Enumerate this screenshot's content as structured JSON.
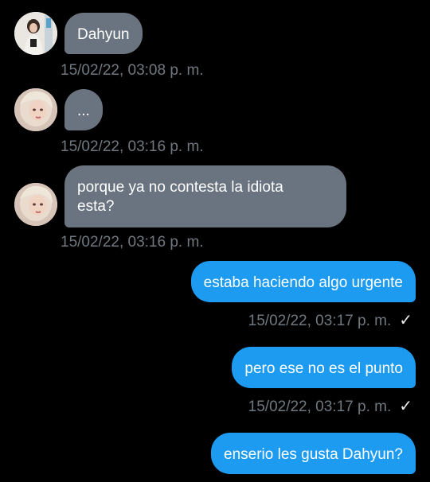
{
  "conversation": {
    "messages": [
      {
        "direction": "in",
        "text": "Dahyun",
        "time": "15/02/22, 03:08 p. m."
      },
      {
        "direction": "in",
        "text": "...",
        "time": "15/02/22, 03:16 p. m."
      },
      {
        "direction": "in",
        "text": "porque ya no contesta la idiota\nesta?",
        "time": "15/02/22, 03:16 p. m."
      },
      {
        "direction": "out",
        "text": "estaba haciendo algo urgente",
        "time": "15/02/22, 03:17 p. m.",
        "status": "✓"
      },
      {
        "direction": "out",
        "text": "pero ese no es el punto",
        "time": "15/02/22, 03:17 p. m.",
        "status": "✓"
      },
      {
        "direction": "out",
        "text": "enserio les gusta Dahyun?"
      }
    ]
  },
  "colors": {
    "background": "#000000",
    "incoming_bubble": "#6a7480",
    "outgoing_bubble": "#1d9bf0",
    "timestamp": "#70787f"
  },
  "icons": {
    "read_receipt": "checkmark-icon",
    "avatar_1": "avatar-photo",
    "avatar_2": "avatar-photo",
    "avatar_3": "avatar-photo"
  }
}
